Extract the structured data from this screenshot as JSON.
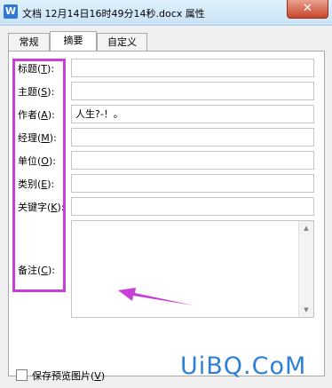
{
  "window": {
    "app_icon_letter": "W",
    "title": "文档 12月14日16时49分14秒.docx 属性",
    "close_label": "✕"
  },
  "tabs": [
    {
      "label": "常规",
      "active": false
    },
    {
      "label": "摘要",
      "active": true
    },
    {
      "label": "自定义",
      "active": false
    }
  ],
  "summary": {
    "fields": [
      {
        "label_pre": "标题(",
        "hotkey": "T",
        "label_post": "):",
        "value": ""
      },
      {
        "label_pre": "主题(",
        "hotkey": "S",
        "label_post": "):",
        "value": ""
      },
      {
        "label_pre": "作者(",
        "hotkey": "A",
        "label_post": "):",
        "value": "人生?-！。"
      },
      {
        "label_pre": "经理(",
        "hotkey": "M",
        "label_post": "):",
        "value": ""
      },
      {
        "label_pre": "单位(",
        "hotkey": "O",
        "label_post": "):",
        "value": ""
      },
      {
        "label_pre": "类别(",
        "hotkey": "E",
        "label_post": "):",
        "value": ""
      },
      {
        "label_pre": "关键字(",
        "hotkey": "K",
        "label_post": "):",
        "value": ""
      }
    ],
    "notes": {
      "label_pre": "备注(",
      "hotkey": "C",
      "label_post": "):",
      "value": ""
    }
  },
  "preview": {
    "label_pre": "保存预览图片(",
    "hotkey": "V",
    "label_post": ")",
    "checked": false
  },
  "watermark": "UiBQ.CoM",
  "colors": {
    "highlight": "#c83fd8",
    "watermark": "#2e7fd6"
  }
}
